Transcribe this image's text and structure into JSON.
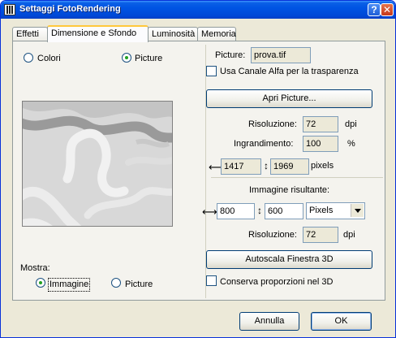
{
  "window": {
    "title": "Settaggi FotoRendering"
  },
  "tabs": [
    {
      "label": "Effetti"
    },
    {
      "label": "Dimensione e Sfondo"
    },
    {
      "label": "Luminosità"
    },
    {
      "label": "Memoria"
    }
  ],
  "left": {
    "radio_colori": "Colori",
    "radio_picture": "Picture",
    "mostra_label": "Mostra:",
    "radio_immagine": "Immagine",
    "radio_picture2": "Picture"
  },
  "right": {
    "picture_label": "Picture:",
    "picture_value": "prova.tif",
    "alpha_label": "Usa Canale Alfa  per la trasparenza",
    "apri_button": "Apri Picture...",
    "risoluzione_label": "Risoluzione:",
    "risoluzione_value": "72",
    "dpi_unit": "dpi",
    "ingrandimento_label": "Ingrandimento:",
    "ingrandimento_value": "100",
    "percent_unit": "%",
    "width_value": "1417",
    "height_value": "1969",
    "pixels_unit": "pixels",
    "immagine_label": "Immagine risultante:",
    "result_width": "800",
    "result_height": "600",
    "units_selected": "Pixels",
    "risoluzione2_label": "Risoluzione:",
    "risoluzione2_value": "72",
    "dpi2_unit": "dpi",
    "autoscala_button": "Autoscala Finestra 3D",
    "conserva_label": "Conserva proporzioni nel 3D"
  },
  "footer": {
    "cancel_button": "Annulla",
    "ok_button": "OK"
  },
  "icons": {
    "app": "app-icon",
    "help": "help-icon",
    "close": "close-icon",
    "width_arrow": "horizontal-arrow-icon",
    "height_arrow": "vertical-arrow-icon",
    "dropdown": "chevron-down-icon"
  },
  "colors": {
    "titlebar": "#0054e3",
    "window_bg": "#ece9d8",
    "tab_highlight": "#ffc83c",
    "radio_dot": "#21a121"
  }
}
